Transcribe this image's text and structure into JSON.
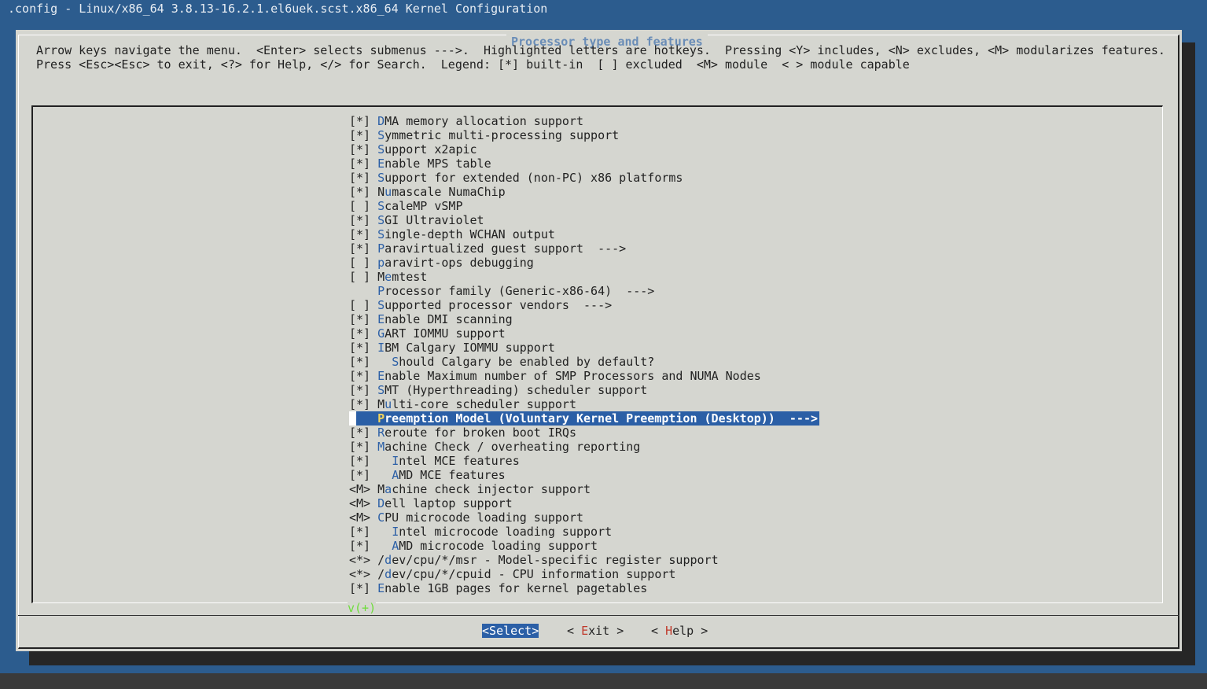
{
  "window_title": ".config - Linux/x86_64 3.8.13-16.2.1.el6uek.scst.x86_64 Kernel Configuration",
  "dialog": {
    "title": "Processor type and features",
    "help_line_1": "Arrow keys navigate the menu.  <Enter> selects submenus --->.  Highlighted letters are hotkeys.  Pressing <Y> includes, <N> excludes, <M> modularizes features.",
    "help_line_2": "Press <Esc><Esc> to exit, <?> for Help, </> for Search.  Legend: [*] built-in  [ ] excluded  <M> module  < > module capable"
  },
  "menu_items": [
    {
      "prefix": "[*] ",
      "indent": "",
      "hotkey": "D",
      "rest": "MA memory allocation support",
      "selected": false
    },
    {
      "prefix": "[*] ",
      "indent": "",
      "hotkey": "S",
      "rest": "ymmetric multi-processing support",
      "selected": false
    },
    {
      "prefix": "[*] ",
      "indent": "",
      "hotkey": "S",
      "rest": "upport x2apic",
      "selected": false
    },
    {
      "prefix": "[*] ",
      "indent": "",
      "hotkey": "E",
      "rest": "nable MPS table",
      "selected": false
    },
    {
      "prefix": "[*] ",
      "indent": "",
      "hotkey": "S",
      "rest": "upport for extended (non-PC) x86 platforms",
      "selected": false
    },
    {
      "prefix": "[*] ",
      "indent": "N",
      "hotkey": "u",
      "rest": "mascale NumaChip",
      "selected": false
    },
    {
      "prefix": "[ ] ",
      "indent": "",
      "hotkey": "S",
      "rest": "caleMP vSMP",
      "selected": false
    },
    {
      "prefix": "[*] ",
      "indent": "",
      "hotkey": "S",
      "rest": "GI Ultraviolet",
      "selected": false
    },
    {
      "prefix": "[*] ",
      "indent": "",
      "hotkey": "S",
      "rest": "ingle-depth WCHAN output",
      "selected": false
    },
    {
      "prefix": "[*] ",
      "indent": "",
      "hotkey": "P",
      "rest": "aravirtualized guest support  --->",
      "selected": false
    },
    {
      "prefix": "[ ] ",
      "indent": "",
      "hotkey": "p",
      "rest": "aravirt-ops debugging",
      "selected": false
    },
    {
      "prefix": "[ ] ",
      "indent": "M",
      "hotkey": "e",
      "rest": "mtest",
      "selected": false
    },
    {
      "prefix": "    ",
      "indent": "",
      "hotkey": "P",
      "rest": "rocessor family (Generic-x86-64)  --->",
      "selected": false
    },
    {
      "prefix": "[ ] ",
      "indent": "",
      "hotkey": "S",
      "rest": "upported processor vendors  --->",
      "selected": false
    },
    {
      "prefix": "[*] ",
      "indent": "",
      "hotkey": "E",
      "rest": "nable DMI scanning",
      "selected": false
    },
    {
      "prefix": "[*] ",
      "indent": "",
      "hotkey": "G",
      "rest": "ART IOMMU support",
      "selected": false
    },
    {
      "prefix": "[*] ",
      "indent": "",
      "hotkey": "I",
      "rest": "BM Calgary IOMMU support",
      "selected": false
    },
    {
      "prefix": "[*] ",
      "indent": "  ",
      "hotkey": "S",
      "rest": "hould Calgary be enabled by default?",
      "selected": false
    },
    {
      "prefix": "[*] ",
      "indent": "",
      "hotkey": "E",
      "rest": "nable Maximum number of SMP Processors and NUMA Nodes",
      "selected": false
    },
    {
      "prefix": "[*] ",
      "indent": "",
      "hotkey": "S",
      "rest": "MT (Hyperthreading) scheduler support",
      "selected": false
    },
    {
      "prefix": "[*] ",
      "indent": "M",
      "hotkey": "u",
      "rest": "lti-core scheduler support",
      "selected": false
    },
    {
      "prefix": "    ",
      "indent": "",
      "hotkey": "P",
      "rest": "reemption Model (Voluntary Kernel Preemption (Desktop))  --->",
      "selected": true
    },
    {
      "prefix": "[*] ",
      "indent": "",
      "hotkey": "R",
      "rest": "eroute for broken boot IRQs",
      "selected": false
    },
    {
      "prefix": "[*] ",
      "indent": "",
      "hotkey": "M",
      "rest": "achine Check / overheating reporting",
      "selected": false
    },
    {
      "prefix": "[*] ",
      "indent": "  ",
      "hotkey": "I",
      "rest": "ntel MCE features",
      "selected": false
    },
    {
      "prefix": "[*] ",
      "indent": "  ",
      "hotkey": "A",
      "rest": "MD MCE features",
      "selected": false
    },
    {
      "prefix": "<M> ",
      "indent": "M",
      "hotkey": "a",
      "rest": "chine check injector support",
      "selected": false
    },
    {
      "prefix": "<M> ",
      "indent": "",
      "hotkey": "D",
      "rest": "ell laptop support",
      "selected": false
    },
    {
      "prefix": "<M> ",
      "indent": "",
      "hotkey": "C",
      "rest": "PU microcode loading support",
      "selected": false
    },
    {
      "prefix": "[*] ",
      "indent": "  ",
      "hotkey": "I",
      "rest": "ntel microcode loading support",
      "selected": false
    },
    {
      "prefix": "[*] ",
      "indent": "  ",
      "hotkey": "A",
      "rest": "MD microcode loading support",
      "selected": false
    },
    {
      "prefix": "<*> ",
      "indent": "/",
      "hotkey": "d",
      "rest": "ev/cpu/*/msr - Model-specific register support",
      "selected": false
    },
    {
      "prefix": "<*> ",
      "indent": "/",
      "hotkey": "d",
      "rest": "ev/cpu/*/cpuid - CPU information support",
      "selected": false
    },
    {
      "prefix": "[*] ",
      "indent": "",
      "hotkey": "E",
      "rest": "nable 1GB pages for kernel pagetables",
      "selected": false
    }
  ],
  "more_indicator": "v(+)",
  "buttons": {
    "select": {
      "open": "<",
      "hotkey": "S",
      "rest": "elect",
      "close": ">"
    },
    "exit": {
      "open": "< ",
      "hotkey": "E",
      "rest": "xit",
      "close": " >"
    },
    "help": {
      "open": "< ",
      "hotkey": "H",
      "rest": "elp",
      "close": " >"
    }
  },
  "colors": {
    "background": "#2c5c8e",
    "dialog": "#d5d6d0",
    "selection": "#2b5fa6",
    "hotkey": "#2b5fa6",
    "selected_hotkey": "#f2d35a",
    "button_hotkey": "#c0392b",
    "more_indicator": "#6fdc3c"
  }
}
